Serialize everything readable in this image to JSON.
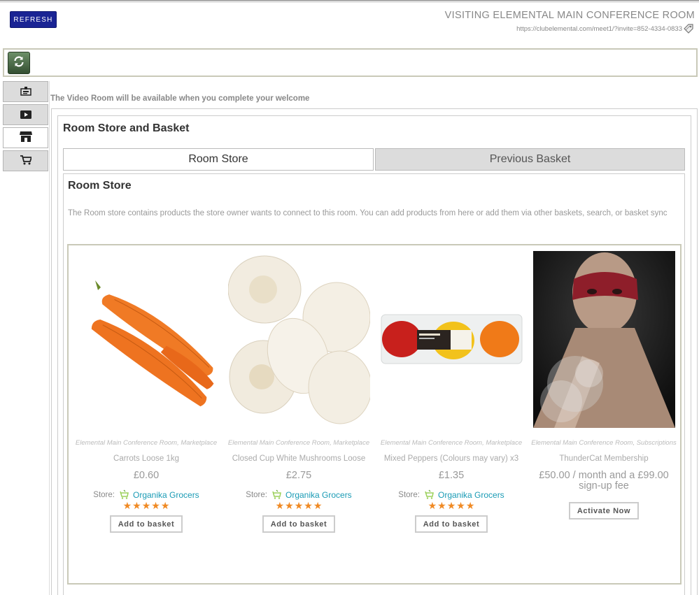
{
  "header": {
    "refresh_label": "REFRESH",
    "room_title": "VISITING ELEMENTAL MAIN CONFERENCE ROOM",
    "room_url": "https://clubelemental.com/meet1/?invite=852-4334-0833"
  },
  "side_nav": {
    "items": [
      {
        "icon": "badge-icon"
      },
      {
        "icon": "video-play-icon"
      },
      {
        "icon": "store-icon"
      },
      {
        "icon": "cart-icon"
      }
    ]
  },
  "video_notice": "The Video Room will be available when you complete your welcome",
  "store_basket": {
    "title": "Room Store and Basket",
    "tabs": [
      {
        "label": "Room Store",
        "active": true
      },
      {
        "label": "Previous Basket",
        "active": false
      }
    ]
  },
  "room_store": {
    "title": "Room Store",
    "description": "The Room store contains products the store owner wants to connect to this room. You can add products from here or add them via other baskets, search, or basket sync",
    "products": [
      {
        "categories": "Elemental Main Conference Room, Marketplace",
        "name": "Carrots Loose 1kg",
        "price": "£0.60",
        "store_label": "Store:",
        "store_name": "Organika Grocers",
        "rating": 5,
        "button": "Add to basket"
      },
      {
        "categories": "Elemental Main Conference Room, Marketplace",
        "name": "Closed Cup White Mushrooms Loose",
        "price": "£2.75",
        "store_label": "Store:",
        "store_name": "Organika Grocers",
        "rating": 5,
        "button": "Add to basket"
      },
      {
        "categories": "Elemental Main Conference Room, Marketplace",
        "name": "Mixed Peppers (Colours may vary) x3",
        "price": "£1.35",
        "store_label": "Store:",
        "store_name": "Organika Grocers",
        "rating": 5,
        "button": "Add to basket"
      },
      {
        "categories": "Elemental Main Conference Room, Subscriptions",
        "name": "ThunderCat Membership",
        "price": "£50.00 / month and a £99.00 sign-up fee",
        "button": "Activate Now"
      }
    ]
  },
  "colors": {
    "refresh_button": "#1a2494",
    "store_link": "#1a9bb5",
    "star": "#f08a24"
  }
}
